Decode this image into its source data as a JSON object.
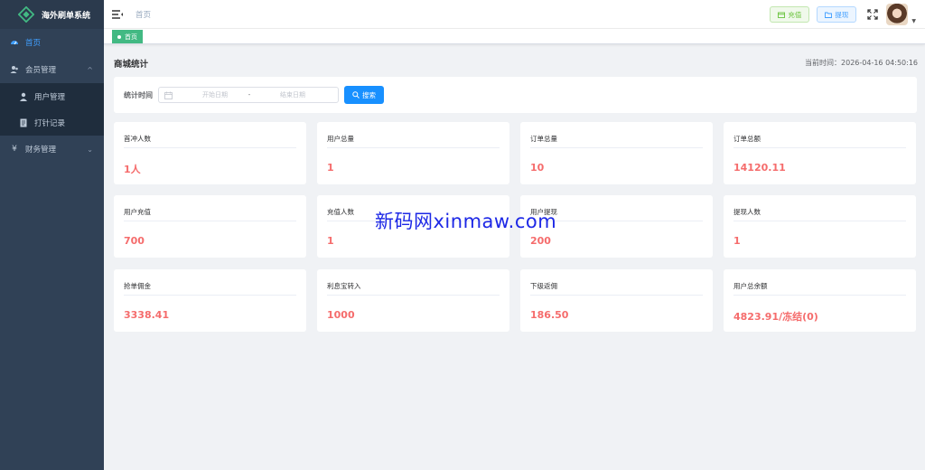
{
  "app": {
    "title": "海外刷单系统"
  },
  "sidebar": {
    "items": [
      {
        "label": "首页",
        "icon": "dashboard-icon"
      },
      {
        "label": "会员管理",
        "icon": "members-icon"
      },
      {
        "label": "用户管理",
        "icon": "user-icon"
      },
      {
        "label": "打针记录",
        "icon": "record-icon"
      },
      {
        "label": "财务管理",
        "icon": "yen-icon"
      }
    ]
  },
  "navbar": {
    "breadcrumb": "首页",
    "recharge_label": "充值",
    "withdraw_label": "提现"
  },
  "tags": [
    {
      "label": "首页"
    }
  ],
  "page": {
    "title": "商城统计",
    "time_label": "当前时间：2026-04-16 04:50:16"
  },
  "filter": {
    "label": "统计时间",
    "start_placeholder": "开始日期",
    "separator": "-",
    "end_placeholder": "结束日期",
    "search_label": "搜索"
  },
  "stats": [
    {
      "label": "首冲人数",
      "value": "1人"
    },
    {
      "label": "用户总量",
      "value": "1"
    },
    {
      "label": "订单总量",
      "value": "10"
    },
    {
      "label": "订单总额",
      "value": "14120.11"
    },
    {
      "label": "用户充值",
      "value": "700"
    },
    {
      "label": "充值人数",
      "value": "1"
    },
    {
      "label": "用户提现",
      "value": "200"
    },
    {
      "label": "提现人数",
      "value": "1"
    },
    {
      "label": "抢单佣金",
      "value": "3338.41"
    },
    {
      "label": "利息宝转入",
      "value": "1000"
    },
    {
      "label": "下级返佣",
      "value": "186.50"
    },
    {
      "label": "用户总余额",
      "value": "4823.91/冻结(0)"
    }
  ],
  "watermark": "新码网xinmaw.com",
  "colors": {
    "sidebar_bg": "#304156",
    "active": "#409eff",
    "value": "#f56c6c",
    "tag": "#42b983",
    "primary": "#1890ff"
  }
}
